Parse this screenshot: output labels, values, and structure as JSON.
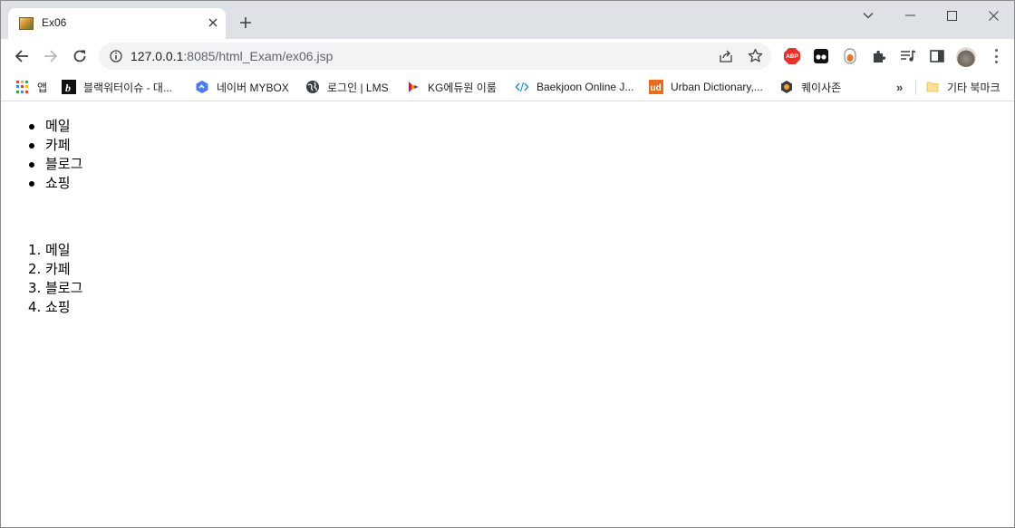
{
  "tab": {
    "title": "Ex06"
  },
  "address": {
    "host": "127.0.0.1",
    "path": ":8085/html_Exam/ex06.jsp"
  },
  "bookmarks": [
    {
      "label": "앱",
      "icon": "apps-grid-icon"
    },
    {
      "label": "블랙워터이슈 - 대...",
      "icon": "b-logo-icon"
    },
    {
      "label": "네이버 MYBOX",
      "icon": "mybox-icon"
    },
    {
      "label": "로그인 | LMS",
      "icon": "globe-icon"
    },
    {
      "label": "KG에듀원 이룸",
      "icon": "kg-logo-icon"
    },
    {
      "label": "Baekjoon Online J...",
      "icon": "code-brackets-icon"
    },
    {
      "label": "Urban Dictionary,...",
      "icon": "ud-logo-icon"
    },
    {
      "label": "퀘이사존",
      "icon": "quasarzone-icon"
    },
    {
      "label": "기타 북마크",
      "icon": "folder-icon"
    }
  ],
  "content": {
    "unordered": [
      "메일",
      "카페",
      "블로그",
      "쇼핑"
    ],
    "ordered": [
      {
        "marker": "1.",
        "text": "메일"
      },
      {
        "marker": "2.",
        "text": "카페"
      },
      {
        "marker": "3.",
        "text": "블로그"
      },
      {
        "marker": "4.",
        "text": "쇼핑"
      }
    ]
  },
  "extensions": {
    "abp_label": "ABP"
  }
}
